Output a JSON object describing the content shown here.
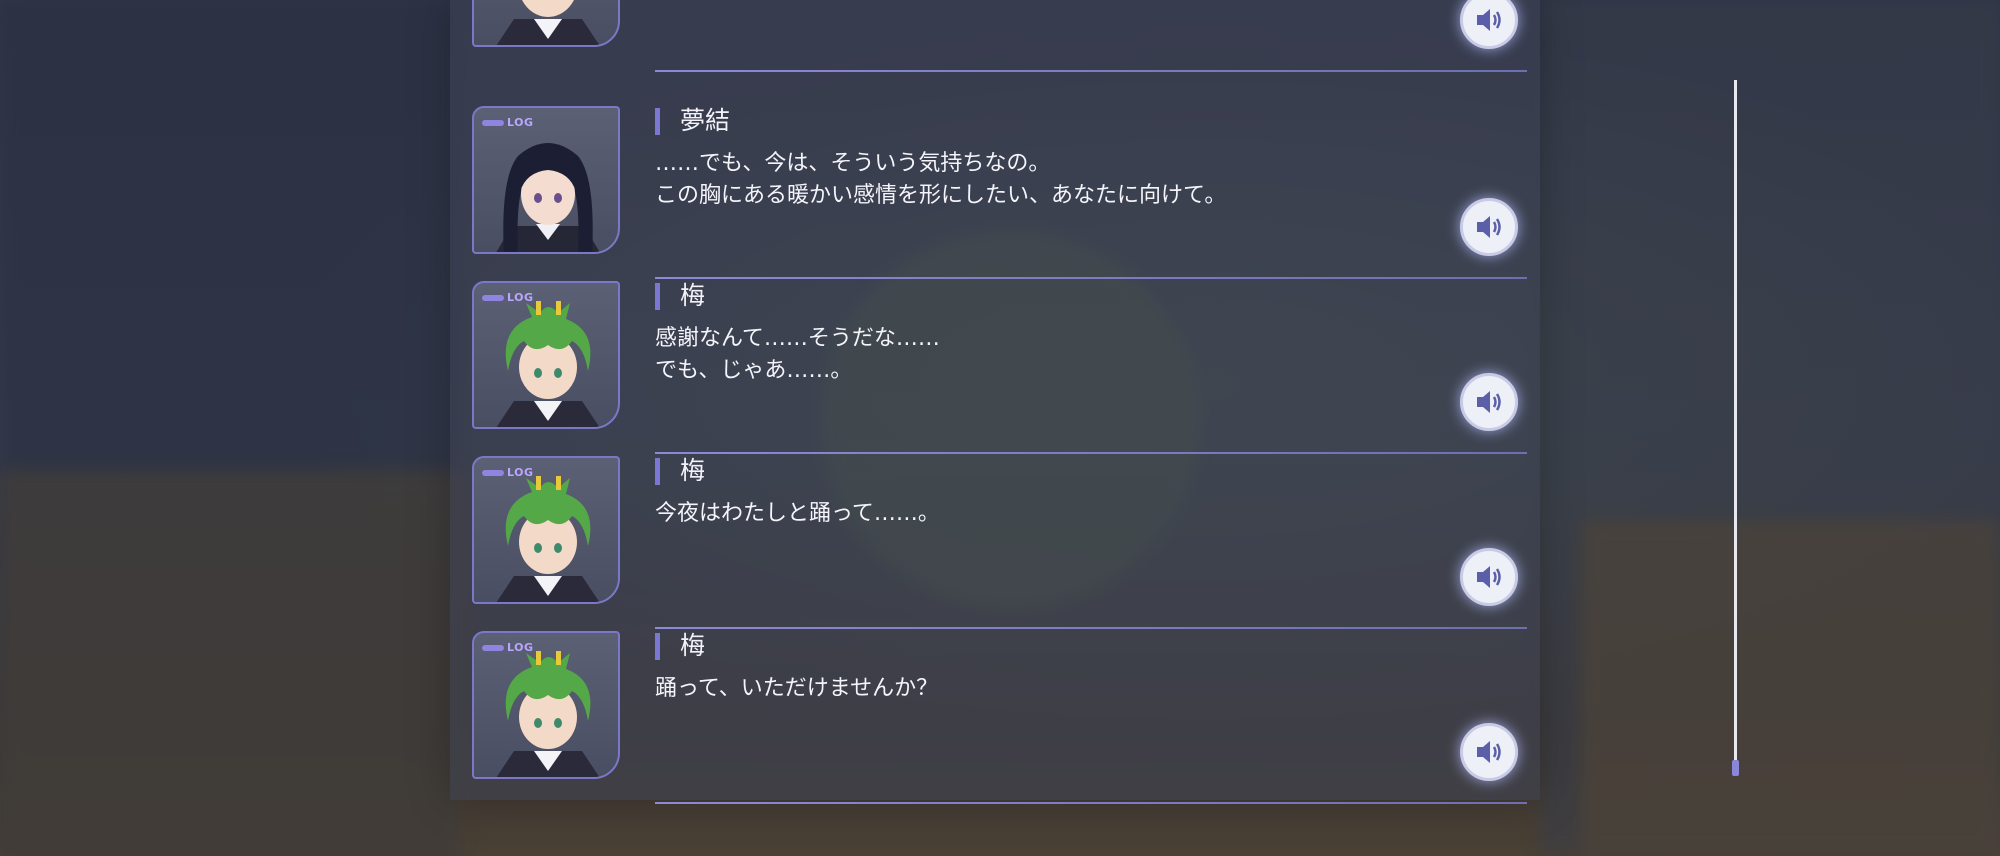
{
  "log": {
    "tag": "LOG",
    "entries": [
      {
        "speaker": "",
        "lines": [],
        "character": "ume",
        "partial": true
      },
      {
        "speaker": "夢結",
        "lines": [
          "……でも、今は、そういう気持ちなの。",
          "この胸にある暖かい感情を形にしたい、あなたに向けて。"
        ],
        "character": "yuyu"
      },
      {
        "speaker": "梅",
        "lines": [
          "感謝なんて……そうだな……",
          "でも、じゃあ……。"
        ],
        "character": "ume"
      },
      {
        "speaker": "梅",
        "lines": [
          "今夜はわたしと踊って……。"
        ],
        "character": "ume"
      },
      {
        "speaker": "梅",
        "lines": [
          "踊って、いただけませんか？"
        ],
        "character": "ume"
      }
    ]
  },
  "icons": {
    "voice": "speaker-icon"
  },
  "colors": {
    "accent": "#7a78d2",
    "separator": "#8c8ad8",
    "scroll_thumb": "#8a86d8"
  }
}
